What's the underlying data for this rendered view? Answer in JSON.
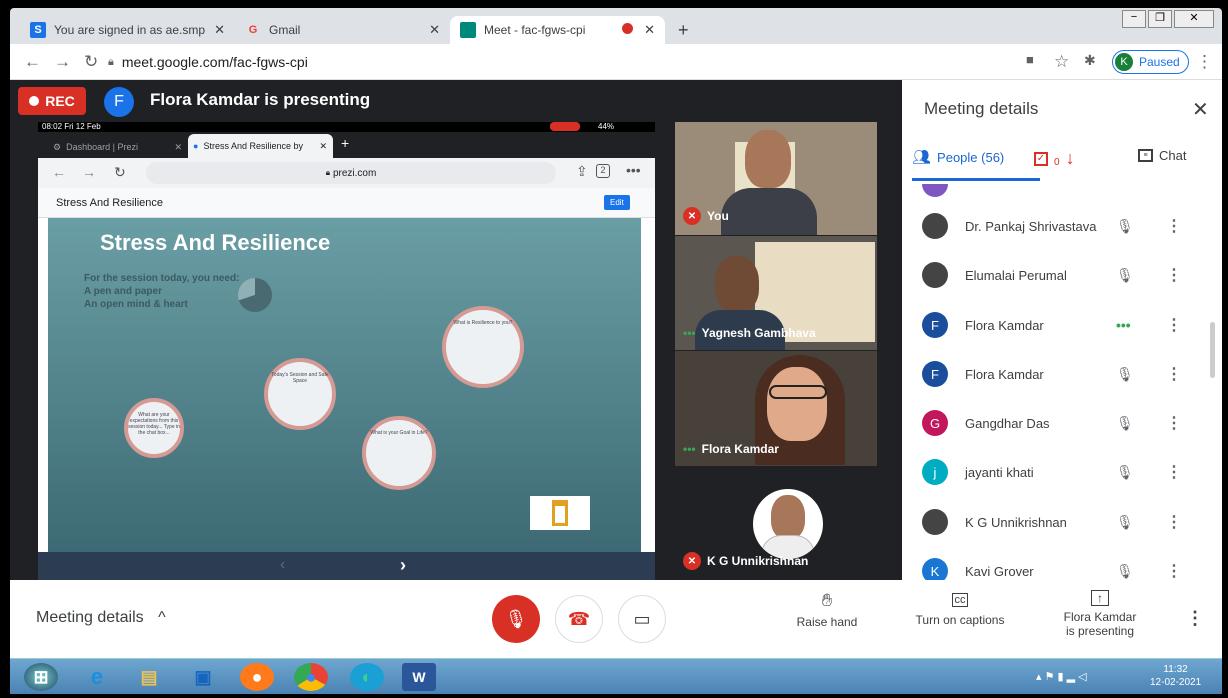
{
  "browser": {
    "tabs": [
      {
        "label": "You are signed in as ae.smp",
        "favicon": "S",
        "color": "#1a73e8"
      },
      {
        "label": "Gmail",
        "favicon": "G",
        "color": "#ea4335"
      },
      {
        "label": "Meet - fac-fgws-cpi",
        "favicon": "M",
        "color": "#00897b"
      }
    ],
    "new_tab": "+",
    "url": "meet.google.com/fac-fgws-cpi",
    "profile_initial": "K",
    "profile_status": "Paused",
    "window_controls": [
      "−",
      "❐",
      "✕"
    ]
  },
  "meet": {
    "rec_label": "REC",
    "presenter_initial": "F",
    "presenter_title": "Flora Kamdar is presenting",
    "shared_screen": {
      "status_time": "08:02  Fri 12 Feb",
      "status_right": "44%",
      "tabs": [
        "Dashboard | Prezi",
        "Stress And Resilience by"
      ],
      "url": "prezi.com",
      "page_title": "Stress And Resilience",
      "edit_label": "Edit",
      "slide_title": "Stress And Resilience",
      "slide_lines": [
        "For the session today, you need:",
        "A pen and paper",
        "An open mind & heart"
      ],
      "bubbles": [
        "What are your expectations from this session today... Type in the chat box...",
        "Today's Session and Safe Space",
        "What is your Goal in Life?",
        "What is Resilience to you?"
      ]
    },
    "tiles": [
      {
        "name": "You",
        "muted": true
      },
      {
        "name": "Yagnesh Gambhava",
        "muted": false
      },
      {
        "name": "Flora Kamdar",
        "muted": false
      },
      {
        "name": "K G Unnikrishnan",
        "muted": true
      }
    ]
  },
  "panel": {
    "title": "Meeting details",
    "people_tab": "People (56)",
    "task_count": "0",
    "chat_tab": "Chat",
    "participants": [
      {
        "name": "Dr. Pankaj Shrivastava",
        "initial": "",
        "color": "#555",
        "status": "muted"
      },
      {
        "name": "Elumalai Perumal",
        "initial": "",
        "color": "#555",
        "status": "muted"
      },
      {
        "name": "Flora Kamdar",
        "initial": "F",
        "color": "#1a4e9c",
        "status": "speaking"
      },
      {
        "name": "Flora Kamdar",
        "initial": "F",
        "color": "#1a4e9c",
        "status": "muted"
      },
      {
        "name": "Gangdhar Das",
        "initial": "G",
        "color": "#c2185b",
        "status": "muted"
      },
      {
        "name": "jayanti khati",
        "initial": "j",
        "color": "#00acc1",
        "status": "muted"
      },
      {
        "name": "K G Unnikrishnan",
        "initial": "",
        "color": "#555",
        "status": "muted"
      },
      {
        "name": "Kavi Grover",
        "initial": "K",
        "color": "#1976d2",
        "status": "muted"
      }
    ]
  },
  "controls": {
    "meeting_details": "Meeting details",
    "raise_hand": "Raise hand",
    "captions": "Turn on captions",
    "presenting_line1": "Flora Kamdar",
    "presenting_line2": "is presenting"
  },
  "taskbar": {
    "time": "11:32",
    "date": "12-02-2021"
  }
}
